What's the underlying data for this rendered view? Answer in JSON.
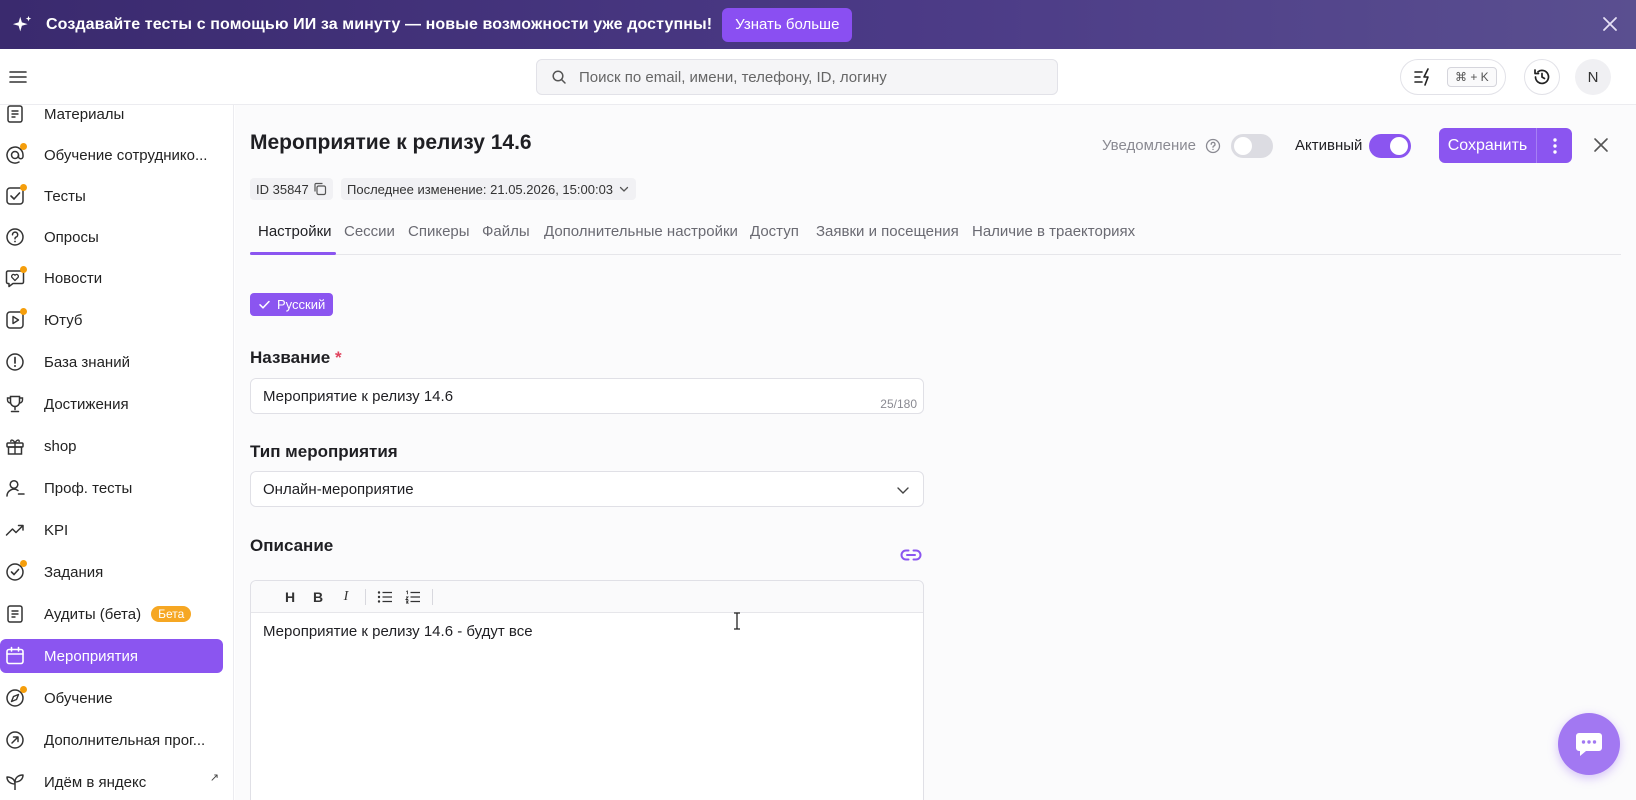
{
  "banner": {
    "text": "Создавайте тесты с помощью ИИ за минуту — новые возможности уже доступны!",
    "button_label": "Узнать больше"
  },
  "header": {
    "search_placeholder": "Поиск по email, имени, телефону, ID, логину",
    "shortcut": "⌘ + K",
    "avatar_initial": "N"
  },
  "sidebar": {
    "items": [
      {
        "label": "Материалы",
        "icon": "document-icon",
        "dot": false
      },
      {
        "label": "Обучение сотруднико...",
        "icon": "mentions-icon",
        "dot": true
      },
      {
        "label": "Тесты",
        "icon": "checklist-icon",
        "dot": true
      },
      {
        "label": "Опросы",
        "icon": "question-icon",
        "dot": false
      },
      {
        "label": "Новости",
        "icon": "heart-chat-icon",
        "dot": true
      },
      {
        "label": "Ютуб",
        "icon": "play-icon",
        "dot": true
      },
      {
        "label": "База знаний",
        "icon": "info-icon",
        "dot": false
      },
      {
        "label": "Достижения",
        "icon": "trophy-icon",
        "dot": false
      },
      {
        "label": "shop",
        "icon": "gift-icon",
        "dot": false
      },
      {
        "label": "Проф. тесты",
        "icon": "user-icon",
        "dot": false
      },
      {
        "label": "KPI",
        "icon": "trend-icon",
        "dot": false
      },
      {
        "label": "Задания",
        "icon": "check-circle-icon",
        "dot": true
      },
      {
        "label": "Аудиты (бета)",
        "icon": "clipboard-icon",
        "dot": false,
        "badge": "Бета"
      },
      {
        "label": "Мероприятия",
        "icon": "calendar-icon",
        "dot": false,
        "active": true
      },
      {
        "label": "Обучение",
        "icon": "compass-icon",
        "dot": true
      },
      {
        "label": "Дополнительная прог...",
        "icon": "arrow-circle-icon",
        "dot": false
      },
      {
        "label": "Идём в яндекс",
        "icon": "leaf-icon",
        "dot": false,
        "external": "↗"
      }
    ]
  },
  "page": {
    "title": "Мероприятие к релизу 14.6",
    "notification_label": "Уведомление",
    "notification_on": false,
    "active_label": "Активный",
    "active_on": true,
    "save_label": "Сохранить",
    "id_label": "ID 35847",
    "last_changed": "Последнее изменение: 21.05.2026, 15:00:03"
  },
  "tabs": [
    {
      "label": "Настройки",
      "active": true
    },
    {
      "label": "Сессии"
    },
    {
      "label": "Спикеры"
    },
    {
      "label": "Файлы"
    },
    {
      "label": "Дополнительные настройки"
    },
    {
      "label": "Доступ"
    },
    {
      "label": "Заявки и посещения"
    },
    {
      "label": "Наличие в траекториях"
    }
  ],
  "form": {
    "language": "Русский",
    "name_label": "Название",
    "required_mark": "*",
    "name_value": "Мероприятие к релизу 14.6",
    "name_counter": "25/180",
    "type_label": "Тип мероприятия",
    "type_value": "Онлайн-мероприятие",
    "description_label": "Описание",
    "toolbar": [
      "H",
      "B",
      "I"
    ],
    "description_text": "Мероприятие к релизу 14.6 - будут все"
  },
  "colors": {
    "accent": "#8b55f0",
    "banner_bg": "#3a2a6e",
    "beta_badge": "#f6a723",
    "dot": "#f59e0b"
  }
}
